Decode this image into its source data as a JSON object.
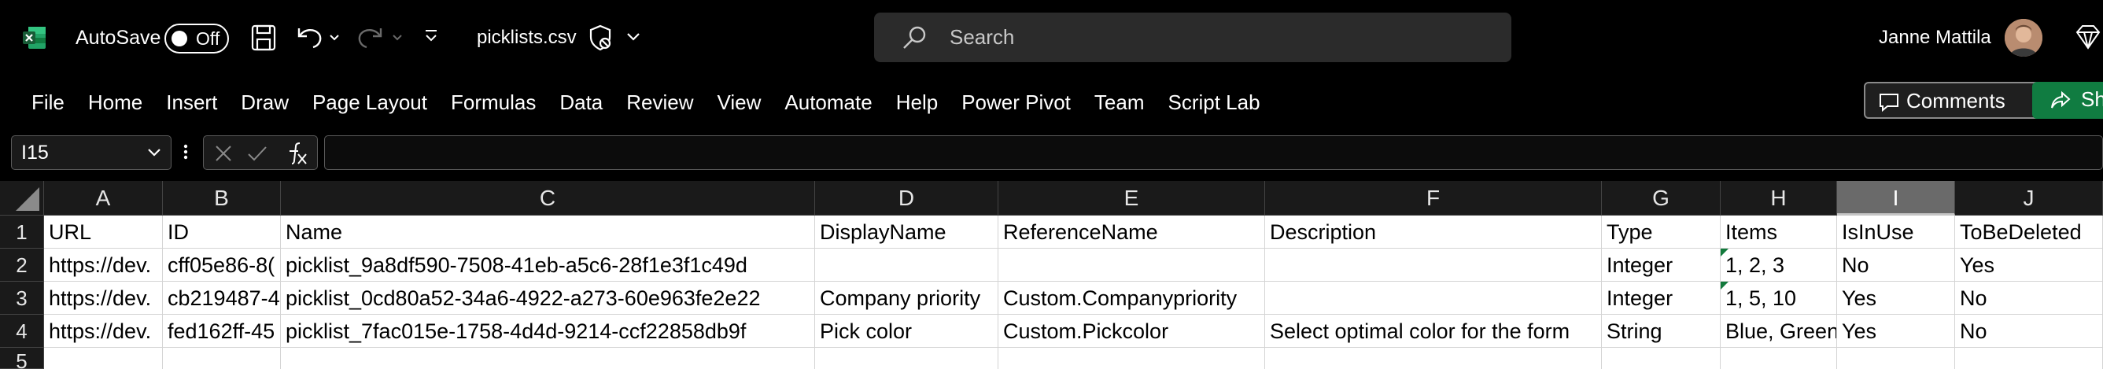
{
  "titlebar": {
    "autosave_label": "AutoSave",
    "autosave_state": "Off",
    "filename": "picklists.csv",
    "search_placeholder": "Search",
    "user_name": "Janne Mattila"
  },
  "ribbon": {
    "tabs": [
      "File",
      "Home",
      "Insert",
      "Draw",
      "Page Layout",
      "Formulas",
      "Data",
      "Review",
      "View",
      "Automate",
      "Help",
      "Power Pivot",
      "Team",
      "Script Lab"
    ],
    "comments_label": "Comments",
    "share_label": "Share"
  },
  "formula_bar": {
    "name_box": "I15",
    "formula": ""
  },
  "grid": {
    "columns": [
      "A",
      "B",
      "C",
      "D",
      "E",
      "F",
      "G",
      "H",
      "I",
      "J"
    ],
    "selected_column": "I",
    "rows": [
      "1",
      "2",
      "3",
      "4",
      "5"
    ],
    "cells": [
      [
        "URL",
        "ID",
        "Name",
        "DisplayName",
        "ReferenceName",
        "Description",
        "Type",
        "Items",
        "IsInUse",
        "ToBeDeleted"
      ],
      [
        "https://dev.",
        "cff05e86-8(",
        "picklist_9a8df590-7508-41eb-a5c6-28f1e3f1c49d",
        "",
        "",
        "",
        "Integer",
        "1, 2, 3",
        "No",
        "Yes"
      ],
      [
        "https://dev.",
        "cb219487-4",
        "picklist_0cd80a52-34a6-4922-a273-60e963fe2e22",
        "Company priority",
        "Custom.Companypriority",
        "",
        "Integer",
        "1, 5, 10",
        "Yes",
        "No"
      ],
      [
        "https://dev.",
        "fed162ff-45",
        "picklist_7fac015e-1758-4d4d-9214-ccf22858db9f",
        "Pick color",
        "Custom.Pickcolor",
        "Select optimal color for the form",
        "String",
        "Blue, Green",
        "Yes",
        "No"
      ],
      [
        "",
        "",
        "",
        "",
        "",
        "",
        "",
        "",
        "",
        ""
      ]
    ]
  },
  "colors": {
    "excel_green": "#107c41",
    "selected_header": "#6a6a6a"
  }
}
